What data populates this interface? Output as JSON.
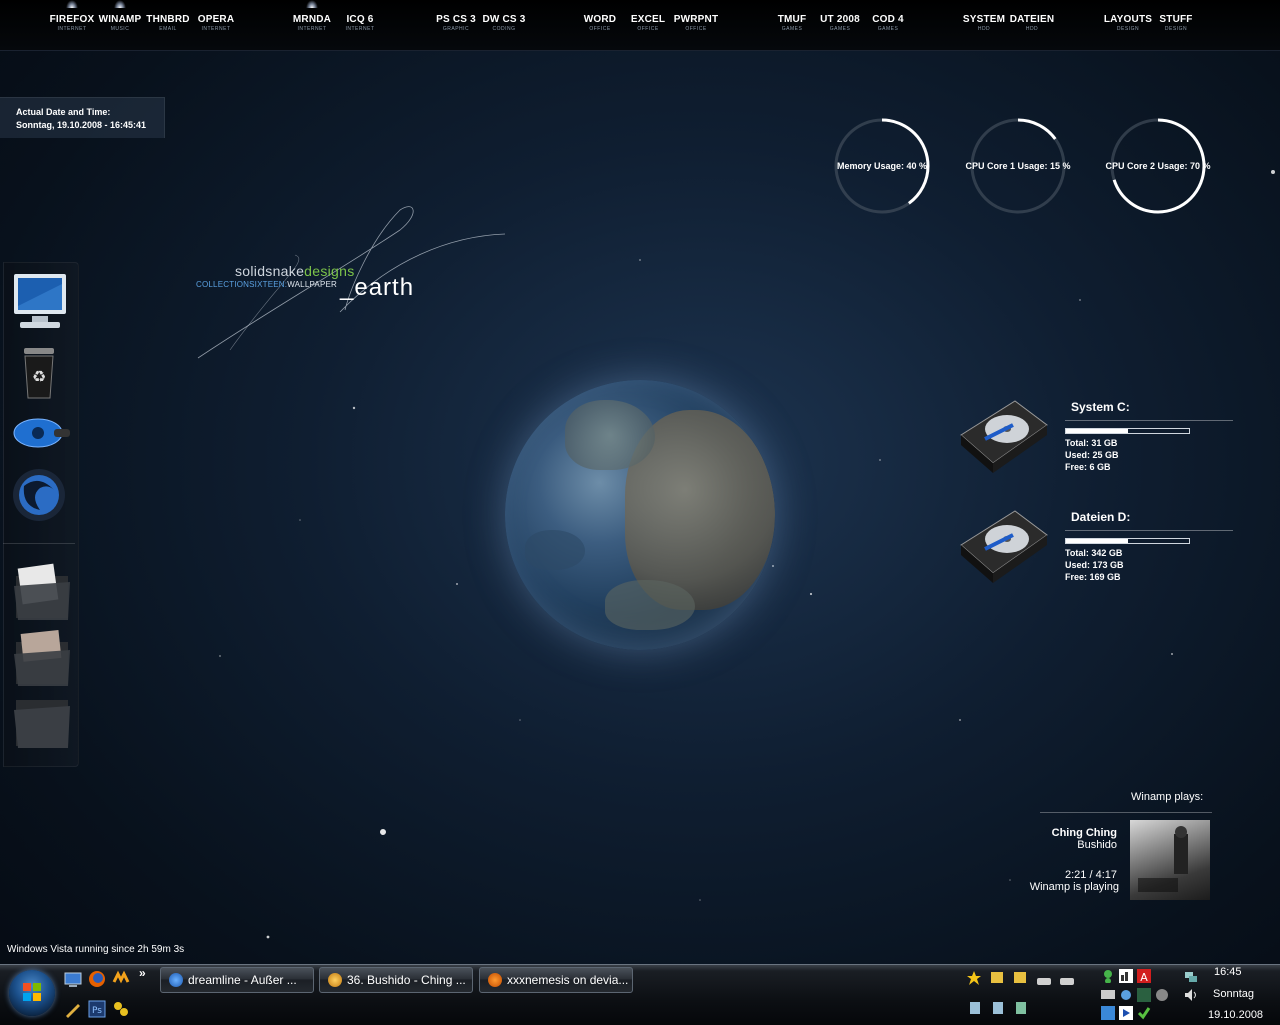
{
  "launcher": [
    {
      "label": "FIREFOX",
      "sub": "INTERNET"
    },
    {
      "label": "WINAMP",
      "sub": "MUSIC"
    },
    {
      "label": "THNBRD",
      "sub": "EMAIL"
    },
    {
      "label": "OPERA",
      "sub": "INTERNET"
    },
    {
      "label": "MRNDA",
      "sub": "INTERNET"
    },
    {
      "label": "ICQ 6",
      "sub": "INTERNET"
    },
    {
      "label": "PS CS 3",
      "sub": "GRAPHIC"
    },
    {
      "label": "DW CS 3",
      "sub": "CODING"
    },
    {
      "label": "WORD",
      "sub": "OFFICE"
    },
    {
      "label": "EXCEL",
      "sub": "OFFICE"
    },
    {
      "label": "PWRPNT",
      "sub": "OFFICE"
    },
    {
      "label": "TMUF",
      "sub": "GAMES"
    },
    {
      "label": "UT 2008",
      "sub": "GAMES"
    },
    {
      "label": "COD 4",
      "sub": "GAMES"
    },
    {
      "label": "SYSTEM",
      "sub": "HDD"
    },
    {
      "label": "DATEIEN",
      "sub": "HDD"
    },
    {
      "label": "LAYOUTS",
      "sub": "DESIGN"
    },
    {
      "label": "STUFF",
      "sub": "DESIGN"
    }
  ],
  "datetime": {
    "title": "Actual Date and Time:",
    "value": "Sonntag, 19.10.2008 - 16:45:41"
  },
  "gauges": [
    {
      "label": "Memory Usage: 40 %",
      "percent": 40
    },
    {
      "label": "CPU Core 1 Usage: 15 %",
      "percent": 15
    },
    {
      "label": "CPU Core 2 Usage: 70 %",
      "percent": 70
    }
  ],
  "logo": {
    "brand_a": "solidsnake",
    "brand_b": "designs",
    "collection": "COLLECTIONSIXTEEN:",
    "wallpaper": "WALLPAPER",
    "title": "_earth"
  },
  "dock": [
    "computer-icon",
    "recycle-bin-icon",
    "sawblade-icon",
    "firefox-orb-icon",
    "documents-folder-icon",
    "pictures-folder-icon",
    "folder-icon"
  ],
  "drives": [
    {
      "title": "System C:",
      "total": "Total: 31 GB",
      "used": "Used: 25 GB",
      "free": "Free: 6 GB",
      "fill": 0.5
    },
    {
      "title": "Dateien D:",
      "total": "Total: 342 GB",
      "used": "Used: 173 GB",
      "free": "Free: 169 GB",
      "fill": 0.5
    }
  ],
  "winamp": {
    "title": "Winamp plays:",
    "song": "Ching Ching",
    "artist": "Bushido",
    "time": "2:21 / 4:17",
    "status": "Winamp is playing"
  },
  "uptime": "Windows Vista running since 2h 59m 3s",
  "taskbar": {
    "overflow": "»",
    "tasks": [
      {
        "label": "dreamline - Außer ...",
        "icon": "weather-icon"
      },
      {
        "label": "36. Bushido - Ching ...",
        "icon": "winamp-icon"
      },
      {
        "label": "xxxnemesis on devia...",
        "icon": "firefox-icon"
      }
    ]
  },
  "clock": {
    "time": "16:45",
    "day": "Sonntag",
    "date": "19.10.2008"
  }
}
